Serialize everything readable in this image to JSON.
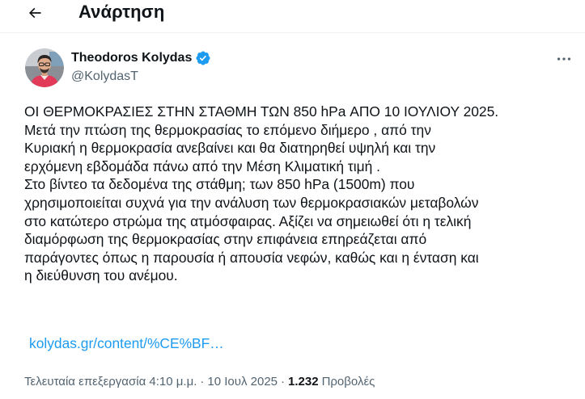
{
  "header": {
    "back_icon": "arrow-left-icon",
    "title": "Ανάρτηση"
  },
  "author": {
    "name": "Theodoros Kolydas",
    "handle": "@KolydasT",
    "verified": true,
    "verified_color": "#1d9bf0",
    "more_icon": "more-horizontal-icon"
  },
  "tweet": {
    "lines": [
      "ΟΙ ΘΕΡΜΟΚΡΑΣΙΕΣ ΣΤΗΝ ΣΤΑΘΜΗ ΤΩΝ 850 hPa ΑΠΟ 10 ΙΟΥΛΙΟΥ 2025.",
      "Μετά την πτώση της θερμοκρασίας το επόμενο διήμερο , από την",
      "Κυριακή η θερμοκρασία ανεβαίνει και θα διατηρηθεί υψηλή και την",
      "ερχόμενη εβδομάδα πάνω από την Μέση Κλιματική τιμή .",
      "Στο βίντεο τα δεδομένα της στάθμη; των 850 hPa (1500m) που",
      "χρησιμοποιείται συχνά για την ανάλυση των θερμοκρασιακών μεταβολών",
      "στο κατώτερο στρώμα της ατμόσφαιρας. Αξίζει να σημειωθεί ότι η τελική",
      "διαμόρφωση της θερμοκρασίας στην επιφάνεια επηρεάζεται από",
      "παράγοντες όπως η παρουσία ή απουσία νεφών, καθώς και η ένταση και",
      "η διεύθυνση του ανέμου."
    ],
    "link": "kolydas.gr/content/%CE%BF…",
    "link_color": "#1d9bf0"
  },
  "meta": {
    "edited_label": "Τελευταία επεξεργασία",
    "time": "4:10 μ.μ.",
    "separator": "·",
    "date": "10 Ιουλ 2025",
    "views_count": "1.232",
    "views_label": "Προβολές"
  }
}
